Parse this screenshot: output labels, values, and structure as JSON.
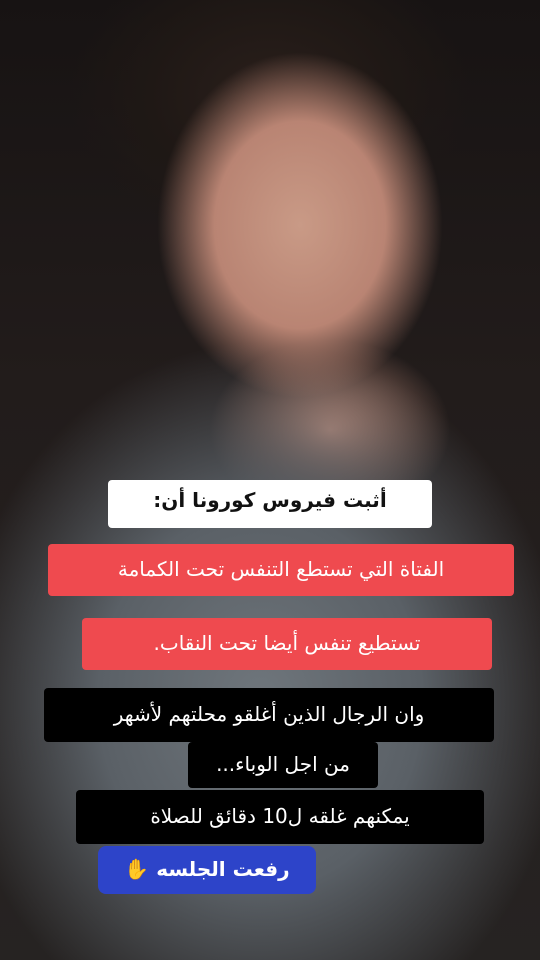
{
  "background": {
    "image": "portrait-photo"
  },
  "captions": {
    "line1": "أثبت فيروس كورونا أن:",
    "line2": "الفتاة التي تستطع التنفس  تحت الكمامة",
    "line3": "تستطيع تنفس أيضا تحت  النقاب.",
    "line4": "وان الرجال الذين أغلقو  محلتهم لأشهر",
    "line5": "من اجل الوباء...",
    "line6": "يمكنهم غلقه ل10 دقائق   للصلاة",
    "line7": "رفعت الجلسه"
  },
  "icons": {
    "hand": "✋"
  },
  "colors": {
    "red": "#ef4a4f",
    "blue": "#2d44c9",
    "white": "#ffffff",
    "black": "#000000"
  }
}
